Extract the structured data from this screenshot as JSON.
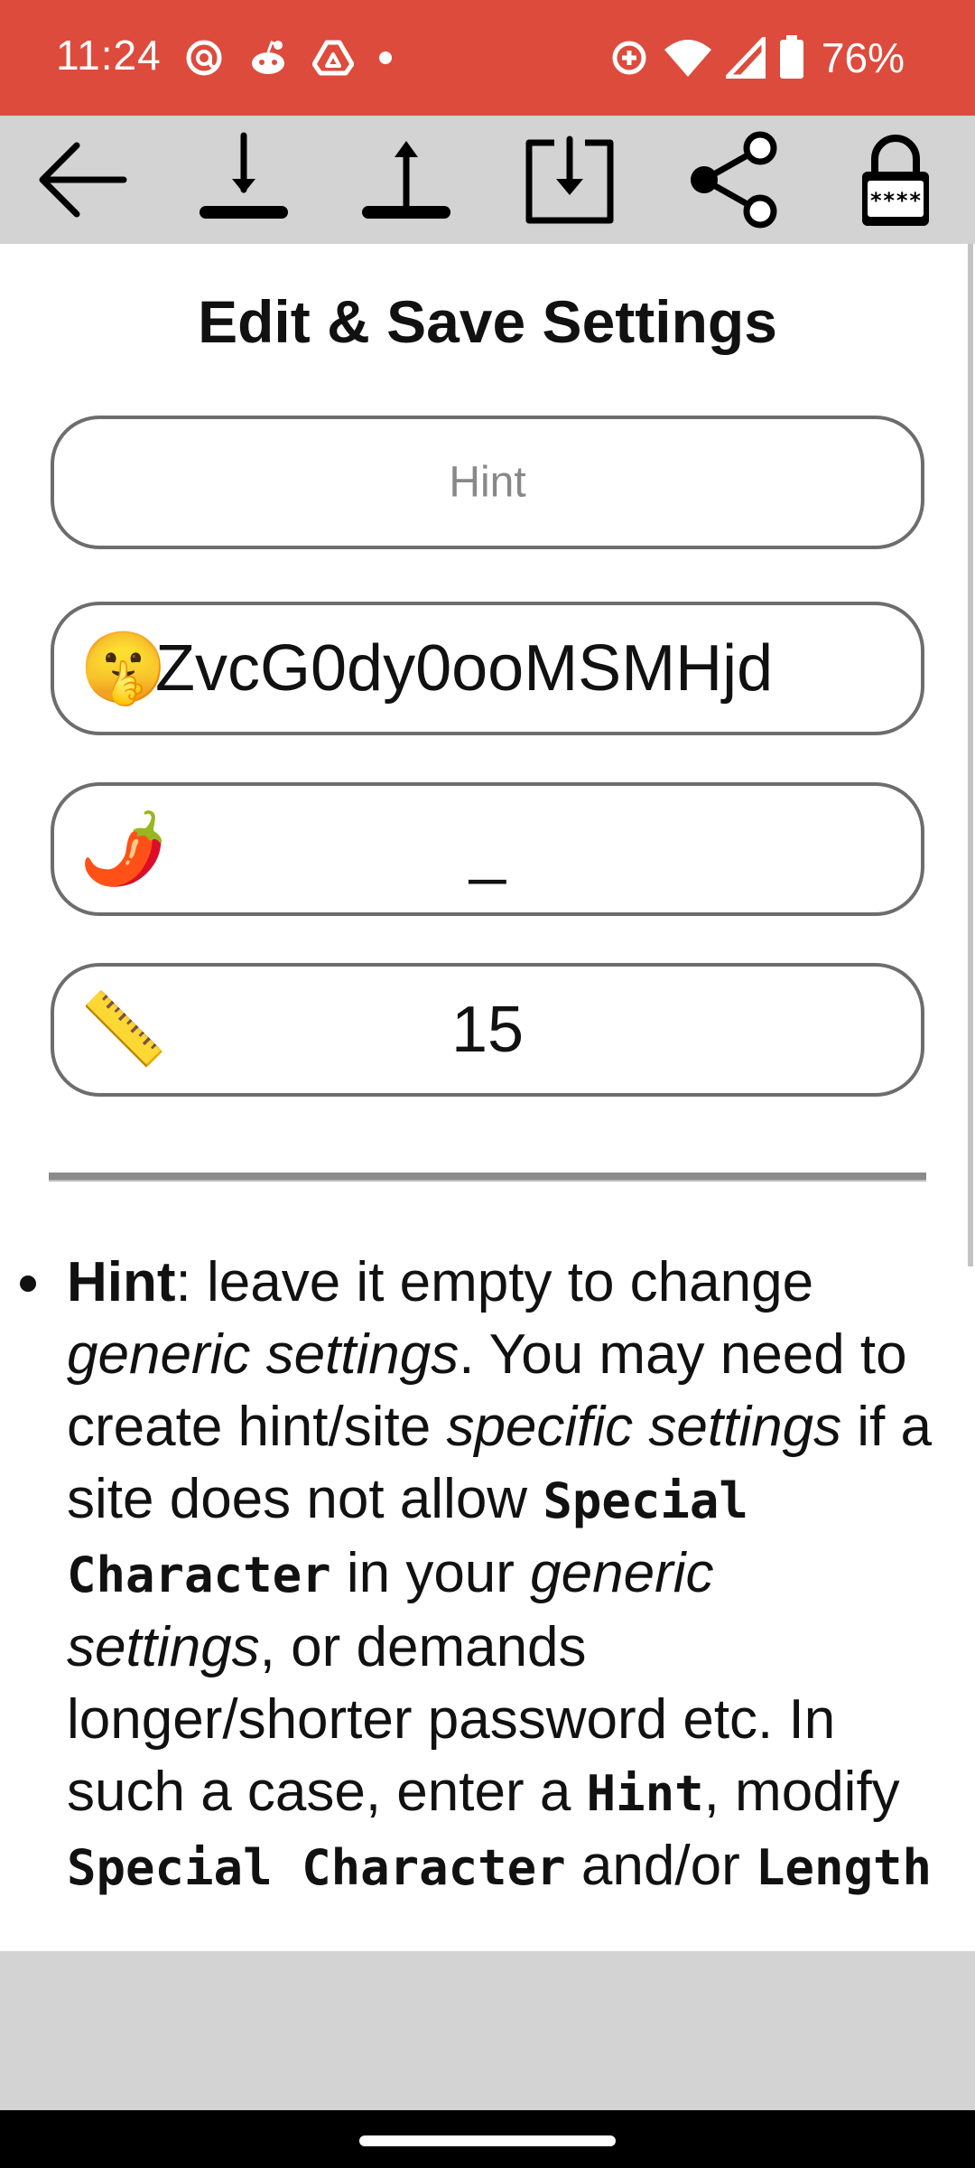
{
  "status_bar": {
    "time": "11:24",
    "battery": "76%",
    "left_icons": [
      "threads-icon",
      "reddit-icon",
      "drive-icon",
      "dot-icon"
    ],
    "right_icons": [
      "data-saver-icon",
      "wifi-icon",
      "signal-icon",
      "battery-icon"
    ]
  },
  "toolbar": {
    "buttons": [
      "back-arrow-icon",
      "download-icon",
      "upload-icon",
      "save-to-device-icon",
      "share-icon",
      "lock-icon"
    ],
    "lock_text": "****"
  },
  "page": {
    "title": "Edit & Save Settings"
  },
  "fields": {
    "hint_placeholder": "Hint",
    "hint_value": "",
    "password_emoji": "🤫",
    "password_value": "ZvcG0dy0ooMSMHjd",
    "special_emoji": "🌶️",
    "special_value": "_",
    "length_emoji": "📏",
    "length_value": "15"
  },
  "help": {
    "hint_term": "Hint",
    "t1": ": leave it empty to change ",
    "generic_settings_1": "generic settings",
    "t2": ". You may need to create hint/site ",
    "specific_settings": "specific settings",
    "t3": " if a site does not allow ",
    "special_character_1": "Special Character",
    "t4": " in your ",
    "generic_settings_2": "generic settings",
    "t5": ", or demands longer/shorter password etc. In such a case, enter a ",
    "hint_term_2": "Hint",
    "t6": ", modify ",
    "special_character_2": "Special Character",
    "t7": " and/or ",
    "length_term": "Length"
  }
}
